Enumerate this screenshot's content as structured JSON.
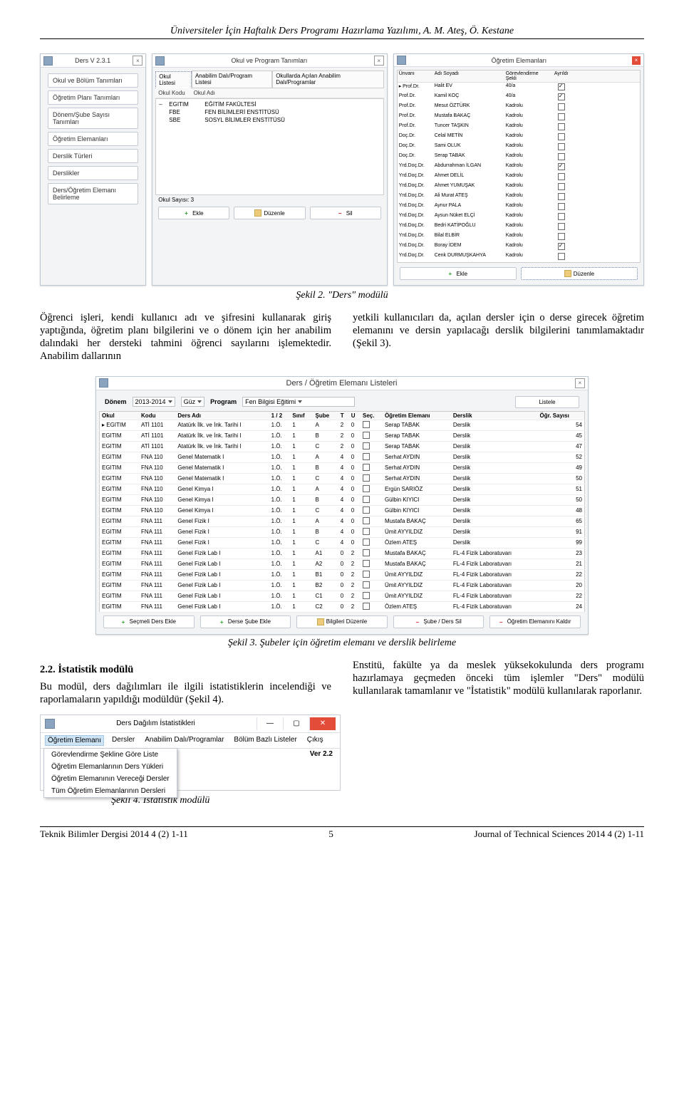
{
  "header": "Üniversiteler İçin Haftalık Ders Programı Hazırlama Yazılımı,   A. M. Ateş, Ö. Kestane",
  "win1": {
    "title": "Ders V 2.3.1",
    "buttons": [
      "Okul ve Bölüm Tanımları",
      "Öğretim Planı Tanımları",
      "Dönem/Şube Sayısı Tanımları",
      "Öğretim Elemanları",
      "Derslik Türleri",
      "Derslikler",
      "Ders/Öğretim Elemanı Belirleme"
    ]
  },
  "win2": {
    "title": "Okul ve Program Tanımları",
    "tabs": [
      "Okul Listesi",
      "Anabilim Dalı/Program Listesi",
      "Okullarda Açılan Anabilim Dalı/Programlar"
    ],
    "cols": [
      "Okul Kodu",
      "Okul Adı"
    ],
    "rows": [
      {
        "code": "EGITIM",
        "name": "EĞİTİM FAKÜLTESİ",
        "expand": "–"
      },
      {
        "code": "FBE",
        "name": "FEN BİLİMLERİ ENSTİTÜSÜ",
        "expand": ""
      },
      {
        "code": "SBE",
        "name": "SOSYL BİLİMLER ENSTİTÜSÜ",
        "expand": ""
      }
    ],
    "count_label": "Okul Sayısı:",
    "count": "3",
    "btns": {
      "add": "Ekle",
      "edit": "Düzenle",
      "del": "Sil"
    }
  },
  "win3": {
    "title": "Öğretim Elemanları",
    "cols": [
      "Ünvanı",
      "Adı Soyadı",
      "Görevlendirme Şekli",
      "Ayrıldı"
    ],
    "rows": [
      {
        "u": "Prof.Dr.",
        "n": "Halit EV",
        "g": "40/a",
        "c": true
      },
      {
        "u": "Prof.Dr.",
        "n": "Kamil KOÇ",
        "g": "40/a",
        "c": true
      },
      {
        "u": "Prof.Dr.",
        "n": "Mesut ÖZTÜRK",
        "g": "Kadrolu",
        "c": false
      },
      {
        "u": "Prof.Dr.",
        "n": "Mustafa BAKAÇ",
        "g": "Kadrolu",
        "c": false
      },
      {
        "u": "Prof.Dr.",
        "n": "Tuncer TAŞKIN",
        "g": "Kadrolu",
        "c": false
      },
      {
        "u": "Doç.Dr.",
        "n": "Celal METİN",
        "g": "Kadrolu",
        "c": false
      },
      {
        "u": "Doç.Dr.",
        "n": "Sami OLUK",
        "g": "Kadrolu",
        "c": false
      },
      {
        "u": "Doç.Dr.",
        "n": "Serap TABAK",
        "g": "Kadrolu",
        "c": false
      },
      {
        "u": "Yrd.Doç.Dr.",
        "n": "Abdurrahman İLGAN",
        "g": "Kadrolu",
        "c": true
      },
      {
        "u": "Yrd.Doç.Dr.",
        "n": "Ahmet DELİL",
        "g": "Kadrolu",
        "c": false
      },
      {
        "u": "Yrd.Doç.Dr.",
        "n": "Ahmet YUMUŞAK",
        "g": "Kadrolu",
        "c": false
      },
      {
        "u": "Yrd.Doç.Dr.",
        "n": "Ali Murat ATEŞ",
        "g": "Kadrolu",
        "c": false
      },
      {
        "u": "Yrd.Doç.Dr.",
        "n": "Aynur PALA",
        "g": "Kadrolu",
        "c": false
      },
      {
        "u": "Yrd.Doç.Dr.",
        "n": "Aysun Nüket ELÇİ",
        "g": "Kadrolu",
        "c": false
      },
      {
        "u": "Yrd.Doç.Dr.",
        "n": "Bedri KATİPOĞLU",
        "g": "Kadrolu",
        "c": false
      },
      {
        "u": "Yrd.Doç.Dr.",
        "n": "Bilal ELBİR",
        "g": "Kadrolu",
        "c": false
      },
      {
        "u": "Yrd.Doç.Dr.",
        "n": "Boray İDEM",
        "g": "Kadrolu",
        "c": true
      },
      {
        "u": "Yrd.Doç.Dr.",
        "n": "Cenk DURMUŞKAHYA",
        "g": "Kadrolu",
        "c": false
      }
    ],
    "btns": {
      "add": "Ekle",
      "edit": "Düzenle"
    }
  },
  "caption2": "Şekil 2. \"Ders\" modülü",
  "para_left": "Öğrenci işleri, kendi kullanıcı adı ve şifresini kullanarak giriş yaptığında, öğretim planı bilgilerini ve o dönem için her anabilim dalındaki her dersteki tahmini öğrenci sayılarını işlemektedir. Anabilim dallarının",
  "para_right": "yetkili kullanıcıları da, açılan dersler için o derse girecek öğretim elemanını ve dersin yapılacağı derslik bilgilerini tanımlamaktadır (Şekil 3).",
  "win4": {
    "title": "Ders / Öğretim Elemanı Listeleri",
    "labels": {
      "donem": "Dönem",
      "program": "Program",
      "listele": "Listele"
    },
    "donem_year": "2013-2014",
    "donem_term": "Güz",
    "program_val": "Fen Bilgisi Eğitimi",
    "cols": [
      "Okul",
      "Kodu",
      "Ders Adı",
      "1 / 2",
      "Sınıf",
      "Şube",
      "T",
      "U",
      "Seç.",
      "Öğretim Elemanı",
      "Derslik",
      "Öğr. Sayısı"
    ],
    "rows": [
      {
        "o": "EGITIM",
        "k": "ATİ 1101",
        "d": "Atatürk İlk. ve İnk. Tarihi I",
        "y": "1.Ö.",
        "s": "1",
        "sb": "A",
        "t": "2",
        "u": "0",
        "sec": false,
        "e": "Serap TABAK",
        "dl": "Derslik",
        "n": "54"
      },
      {
        "o": "EGITIM",
        "k": "ATİ 1101",
        "d": "Atatürk İlk. ve İnk. Tarihi I",
        "y": "1.Ö.",
        "s": "1",
        "sb": "B",
        "t": "2",
        "u": "0",
        "sec": false,
        "e": "Serap TABAK",
        "dl": "Derslik",
        "n": "45"
      },
      {
        "o": "EGITIM",
        "k": "ATİ 1101",
        "d": "Atatürk İlk. ve İnk. Tarihi I",
        "y": "1.Ö.",
        "s": "1",
        "sb": "C",
        "t": "2",
        "u": "0",
        "sec": false,
        "e": "Serap TABAK",
        "dl": "Derslik",
        "n": "47"
      },
      {
        "o": "EGITIM",
        "k": "FNA 110",
        "d": "Genel Matematik I",
        "y": "1.Ö.",
        "s": "1",
        "sb": "A",
        "t": "4",
        "u": "0",
        "sec": false,
        "e": "Serhat AYDIN",
        "dl": "Derslik",
        "n": "52"
      },
      {
        "o": "EGITIM",
        "k": "FNA 110",
        "d": "Genel Matematik I",
        "y": "1.Ö.",
        "s": "1",
        "sb": "B",
        "t": "4",
        "u": "0",
        "sec": false,
        "e": "Serhat AYDIN",
        "dl": "Derslik",
        "n": "49"
      },
      {
        "o": "EGITIM",
        "k": "FNA 110",
        "d": "Genel Matematik I",
        "y": "1.Ö.",
        "s": "1",
        "sb": "C",
        "t": "4",
        "u": "0",
        "sec": false,
        "e": "Serhat AYDIN",
        "dl": "Derslik",
        "n": "50"
      },
      {
        "o": "EGITIM",
        "k": "FNA 110",
        "d": "Genel Kimya I",
        "y": "1.Ö.",
        "s": "1",
        "sb": "A",
        "t": "4",
        "u": "0",
        "sec": false,
        "e": "Ergün SARIÖZ",
        "dl": "Derslik",
        "n": "51"
      },
      {
        "o": "EGITIM",
        "k": "FNA 110",
        "d": "Genel Kimya I",
        "y": "1.Ö.",
        "s": "1",
        "sb": "B",
        "t": "4",
        "u": "0",
        "sec": false,
        "e": "Gülbin KIYICI",
        "dl": "Derslik",
        "n": "50"
      },
      {
        "o": "EGITIM",
        "k": "FNA 110",
        "d": "Genel Kimya I",
        "y": "1.Ö.",
        "s": "1",
        "sb": "C",
        "t": "4",
        "u": "0",
        "sec": false,
        "e": "Gülbin KIYICI",
        "dl": "Derslik",
        "n": "48"
      },
      {
        "o": "EGITIM",
        "k": "FNA 111",
        "d": "Genel Fizik I",
        "y": "1.Ö.",
        "s": "1",
        "sb": "A",
        "t": "4",
        "u": "0",
        "sec": false,
        "e": "Mustafa BAKAÇ",
        "dl": "Derslik",
        "n": "65"
      },
      {
        "o": "EGITIM",
        "k": "FNA 111",
        "d": "Genel Fizik I",
        "y": "1.Ö.",
        "s": "1",
        "sb": "B",
        "t": "4",
        "u": "0",
        "sec": false,
        "e": "Ümit AYYILDIZ",
        "dl": "Derslik",
        "n": "91"
      },
      {
        "o": "EGITIM",
        "k": "FNA 111",
        "d": "Genel Fizik I",
        "y": "1.Ö.",
        "s": "1",
        "sb": "C",
        "t": "4",
        "u": "0",
        "sec": false,
        "e": "Özlem ATEŞ",
        "dl": "Derslik",
        "n": "99"
      },
      {
        "o": "EGITIM",
        "k": "FNA 111",
        "d": "Genel Fizik Lab I",
        "y": "1.Ö.",
        "s": "1",
        "sb": "A1",
        "t": "0",
        "u": "2",
        "sec": false,
        "e": "Mustafa BAKAÇ",
        "dl": "FL-4 Fizik Laboratuvarı",
        "n": "23"
      },
      {
        "o": "EGITIM",
        "k": "FNA 111",
        "d": "Genel Fizik Lab I",
        "y": "1.Ö.",
        "s": "1",
        "sb": "A2",
        "t": "0",
        "u": "2",
        "sec": false,
        "e": "Mustafa BAKAÇ",
        "dl": "FL-4 Fizik Laboratuvarı",
        "n": "21"
      },
      {
        "o": "EGITIM",
        "k": "FNA 111",
        "d": "Genel Fizik Lab I",
        "y": "1.Ö.",
        "s": "1",
        "sb": "B1",
        "t": "0",
        "u": "2",
        "sec": false,
        "e": "Ümit AYYILDIZ",
        "dl": "FL-4 Fizik Laboratuvarı",
        "n": "22"
      },
      {
        "o": "EGITIM",
        "k": "FNA 111",
        "d": "Genel Fizik Lab I",
        "y": "1.Ö.",
        "s": "1",
        "sb": "B2",
        "t": "0",
        "u": "2",
        "sec": false,
        "e": "Ümit AYYILDIZ",
        "dl": "FL-4 Fizik Laboratuvarı",
        "n": "20"
      },
      {
        "o": "EGITIM",
        "k": "FNA 111",
        "d": "Genel Fizik Lab I",
        "y": "1.Ö.",
        "s": "1",
        "sb": "C1",
        "t": "0",
        "u": "2",
        "sec": false,
        "e": "Ümit AYYILDIZ",
        "dl": "FL-4 Fizik Laboratuvarı",
        "n": "22"
      },
      {
        "o": "EGITIM",
        "k": "FNA 111",
        "d": "Genel Fizik Lab I",
        "y": "1.Ö.",
        "s": "1",
        "sb": "C2",
        "t": "0",
        "u": "2",
        "sec": false,
        "e": "Özlem ATEŞ",
        "dl": "FL-4 Fizik Laboratuvarı",
        "n": "24"
      }
    ],
    "btns": {
      "a": "Seçmeli Ders Ekle",
      "b": "Derse Şube Ekle",
      "c": "Bilgileri Düzenle",
      "d": "Şube / Ders Sil",
      "e": "Öğretim Elemanını Kaldır"
    }
  },
  "caption3": "Şekil 3. Şubeler için öğretim elemanı ve derslik belirleme",
  "section22_title": "2.2. İstatistik modülü",
  "section22_left": "Bu modül, ders dağılımları ile ilgili istatistiklerin incelendiği ve raporlamaların yapıldığı modüldür (Şekil 4).",
  "section22_right": "Enstitü, fakülte ya da meslek yüksekokulunda ders programı hazırlamaya geçmeden önceki tüm işlemler \"Ders\" modülü kullanılarak tamamlanır ve \"İstatistik\" modülü kullanılarak raporlanır.",
  "statwin": {
    "title": "Ders Dağılım İstatistikleri",
    "menus": [
      "Öğretim Elemanı",
      "Dersler",
      "Anabilim Dalı/Programlar",
      "Bölüm Bazlı Listeler",
      "Çıkış"
    ],
    "dropdown": [
      "Görevlendirme Şekline Göre Liste",
      "Öğretim Elemanlarının Ders Yükleri",
      "Öğretim Elemanının Vereceği Dersler",
      "Tüm Öğretim Elemanlarının Dersleri"
    ],
    "version": "Ver 2.2"
  },
  "caption4": "Şekil 4. İstatistik modülü",
  "footer": {
    "left": "Teknik Bilimler Dergisi 2014  4 (2) 1-11",
    "center": "5",
    "right": "Journal of Technical Sciences 2014 4 (2) 1-11"
  }
}
